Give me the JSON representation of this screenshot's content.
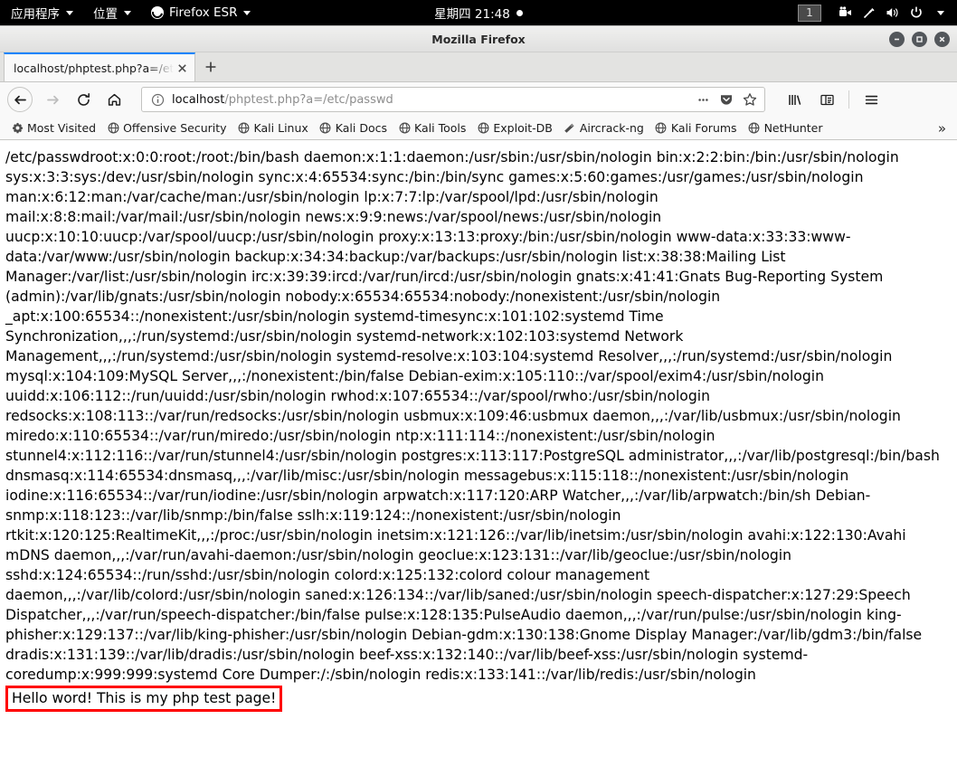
{
  "desktop_panel": {
    "applications_label": "应用程序",
    "places_label": "位置",
    "firefox_label": "Firefox ESR",
    "clock": "星期四 21:48",
    "workspace": "1"
  },
  "window": {
    "title": "Mozilla Firefox"
  },
  "tabs": [
    {
      "label": "localhost/phptest.php?a=/et"
    }
  ],
  "navigation": {
    "url_host": "localhost",
    "url_path": "/phptest.php?a=/etc/passwd",
    "url_full": "localhost/phptest.php?a=/etc/passwd"
  },
  "bookmarks": [
    {
      "label": "Most Visited",
      "icon": "gear-icon"
    },
    {
      "label": "Offensive Security",
      "icon": "globe-icon"
    },
    {
      "label": "Kali Linux",
      "icon": "globe-icon"
    },
    {
      "label": "Kali Docs",
      "icon": "globe-icon"
    },
    {
      "label": "Kali Tools",
      "icon": "globe-icon"
    },
    {
      "label": "Exploit-DB",
      "icon": "globe-icon"
    },
    {
      "label": "Aircrack-ng",
      "icon": "aircrack-icon"
    },
    {
      "label": "Kali Forums",
      "icon": "globe-icon"
    },
    {
      "label": "NetHunter",
      "icon": "globe-icon"
    }
  ],
  "bookmarks_overflow_label": "»",
  "page_content": {
    "passwd_dump": "/etc/passwdroot:x:0:0:root:/root:/bin/bash daemon:x:1:1:daemon:/usr/sbin:/usr/sbin/nologin bin:x:2:2:bin:/bin:/usr/sbin/nologin sys:x:3:3:sys:/dev:/usr/sbin/nologin sync:x:4:65534:sync:/bin:/bin/sync games:x:5:60:games:/usr/games:/usr/sbin/nologin man:x:6:12:man:/var/cache/man:/usr/sbin/nologin lp:x:7:7:lp:/var/spool/lpd:/usr/sbin/nologin mail:x:8:8:mail:/var/mail:/usr/sbin/nologin news:x:9:9:news:/var/spool/news:/usr/sbin/nologin uucp:x:10:10:uucp:/var/spool/uucp:/usr/sbin/nologin proxy:x:13:13:proxy:/bin:/usr/sbin/nologin www-data:x:33:33:www-data:/var/www:/usr/sbin/nologin backup:x:34:34:backup:/var/backups:/usr/sbin/nologin list:x:38:38:Mailing List Manager:/var/list:/usr/sbin/nologin irc:x:39:39:ircd:/var/run/ircd:/usr/sbin/nologin gnats:x:41:41:Gnats Bug-Reporting System (admin):/var/lib/gnats:/usr/sbin/nologin nobody:x:65534:65534:nobody:/nonexistent:/usr/sbin/nologin _apt:x:100:65534::/nonexistent:/usr/sbin/nologin systemd-timesync:x:101:102:systemd Time Synchronization,,,:/run/systemd:/usr/sbin/nologin systemd-network:x:102:103:systemd Network Management,,,:/run/systemd:/usr/sbin/nologin systemd-resolve:x:103:104:systemd Resolver,,,:/run/systemd:/usr/sbin/nologin mysql:x:104:109:MySQL Server,,,:/nonexistent:/bin/false Debian-exim:x:105:110::/var/spool/exim4:/usr/sbin/nologin uuidd:x:106:112::/run/uuidd:/usr/sbin/nologin rwhod:x:107:65534::/var/spool/rwho:/usr/sbin/nologin redsocks:x:108:113::/var/run/redsocks:/usr/sbin/nologin usbmux:x:109:46:usbmux daemon,,,:/var/lib/usbmux:/usr/sbin/nologin miredo:x:110:65534::/var/run/miredo:/usr/sbin/nologin ntp:x:111:114::/nonexistent:/usr/sbin/nologin stunnel4:x:112:116::/var/run/stunnel4:/usr/sbin/nologin postgres:x:113:117:PostgreSQL administrator,,,:/var/lib/postgresql:/bin/bash dnsmasq:x:114:65534:dnsmasq,,,:/var/lib/misc:/usr/sbin/nologin messagebus:x:115:118::/nonexistent:/usr/sbin/nologin iodine:x:116:65534::/var/run/iodine:/usr/sbin/nologin arpwatch:x:117:120:ARP Watcher,,,:/var/lib/arpwatch:/bin/sh Debian-snmp:x:118:123::/var/lib/snmp:/bin/false sslh:x:119:124::/nonexistent:/usr/sbin/nologin rtkit:x:120:125:RealtimeKit,,,:/proc:/usr/sbin/nologin inetsim:x:121:126::/var/lib/inetsim:/usr/sbin/nologin avahi:x:122:130:Avahi mDNS daemon,,,:/var/run/avahi-daemon:/usr/sbin/nologin geoclue:x:123:131::/var/lib/geoclue:/usr/sbin/nologin sshd:x:124:65534::/run/sshd:/usr/sbin/nologin colord:x:125:132:colord colour management daemon,,,:/var/lib/colord:/usr/sbin/nologin saned:x:126:134::/var/lib/saned:/usr/sbin/nologin speech-dispatcher:x:127:29:Speech Dispatcher,,,:/var/run/speech-dispatcher:/bin/false pulse:x:128:135:PulseAudio daemon,,,:/var/run/pulse:/usr/sbin/nologin king-phisher:x:129:137::/var/lib/king-phisher:/usr/sbin/nologin Debian-gdm:x:130:138:Gnome Display Manager:/var/lib/gdm3:/bin/false dradis:x:131:139::/var/lib/dradis:/usr/sbin/nologin beef-xss:x:132:140::/var/lib/beef-xss:/usr/sbin/nologin systemd-coredump:x:999:999:systemd Core Dumper:/:/sbin/nologin redis:x:133:141::/var/lib/redis:/usr/sbin/nologin",
    "hello_message": "Hello word! This is my php test page!"
  },
  "colors": {
    "annotation_red": "#ff0000",
    "tab_accent": "#0a84ff",
    "panel_bg": "#000000"
  }
}
